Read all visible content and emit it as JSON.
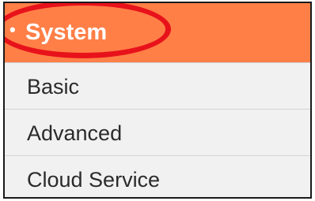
{
  "menu": {
    "header": {
      "bullet": "•",
      "label": "System"
    },
    "items": [
      {
        "label": "Basic"
      },
      {
        "label": "Advanced"
      },
      {
        "label": "Cloud Service"
      }
    ]
  },
  "colors": {
    "header_bg": "#ff7f47",
    "highlight_ring": "#e8121b",
    "item_bg": "#f1f1f1",
    "text": "#2b2b2b"
  }
}
